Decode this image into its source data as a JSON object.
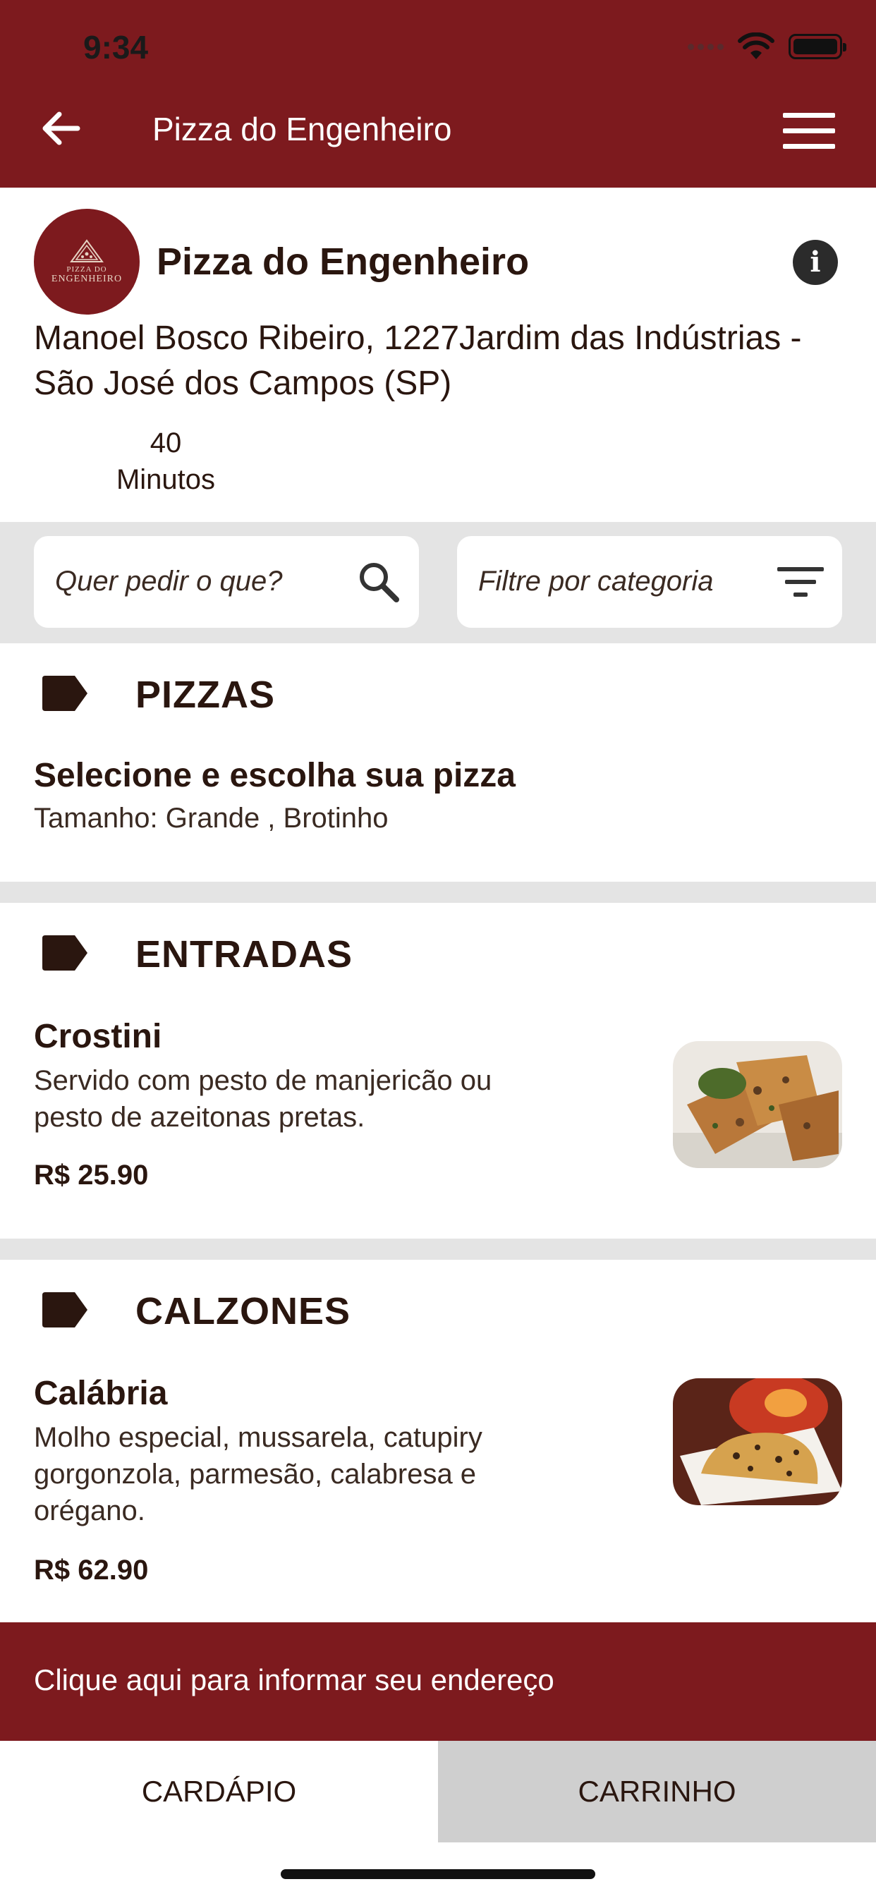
{
  "status_bar": {
    "time": "9:34"
  },
  "nav": {
    "title": "Pizza do Engenheiro"
  },
  "store": {
    "name": "Pizza do Engenheiro",
    "logo_line1": "PIZZA DO",
    "logo_line2": "ENGENHEIRO",
    "address": "Manoel Bosco Ribeiro, 1227Jardim das Indústrias - São José dos Campos (SP)",
    "eta_value": "40",
    "eta_unit": "Minutos"
  },
  "search": {
    "placeholder": "Quer pedir o que?",
    "filter_placeholder": "Filtre por categoria"
  },
  "sections": [
    {
      "title": "PIZZAS",
      "item_name": "Selecione e escolha sua pizza",
      "item_desc": "Tamanho: Grande , Brotinho"
    },
    {
      "title": "ENTRADAS",
      "item_name": "Crostini",
      "item_desc": "Servido com pesto de manjericão ou pesto de azeitonas pretas.",
      "item_price": "R$ 25.90"
    },
    {
      "title": "CALZONES",
      "item_name": "Calábria",
      "item_desc": "Molho especial, mussarela, catupiry gorgonzola, parmesão, calabresa e orégano.",
      "item_price": "R$ 62.90"
    }
  ],
  "address_banner": "Clique aqui para informar seu endereço",
  "tabs": [
    {
      "label": "CARDÁPIO"
    },
    {
      "label": "CARRINHO"
    }
  ],
  "colors": {
    "brand": "#7d1a1e",
    "text": "#2a160f",
    "band": "#e4e4e4",
    "inactive_tab": "#cfcfcf"
  },
  "icons": {
    "back": "arrow-left-icon",
    "menu": "hamburger-menu-icon",
    "info": "info-icon",
    "search": "search-icon",
    "filter": "filter-icon",
    "category": "tag-icon"
  }
}
